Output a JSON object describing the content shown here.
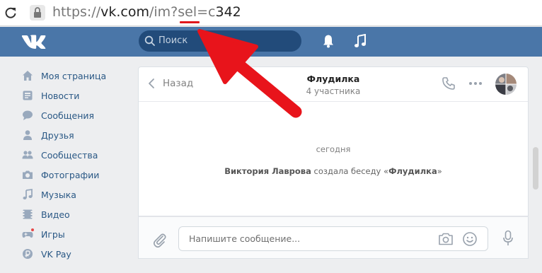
{
  "browser": {
    "url_proto": "https://",
    "url_host": "vk.com",
    "url_path": "/im?sel=c",
    "url_highlight": "342"
  },
  "header": {
    "search_placeholder": "Поиск",
    "brand_color": "#4a76a8"
  },
  "sidebar": {
    "items": [
      {
        "label": "Моя страница",
        "icon": "home-icon"
      },
      {
        "label": "Новости",
        "icon": "news-icon"
      },
      {
        "label": "Сообщения",
        "icon": "messages-icon"
      },
      {
        "label": "Друзья",
        "icon": "friend-icon"
      },
      {
        "label": "Сообщества",
        "icon": "communities-icon"
      },
      {
        "label": "Фотографии",
        "icon": "camera-icon"
      },
      {
        "label": "Музыка",
        "icon": "music-icon"
      },
      {
        "label": "Видео",
        "icon": "video-icon"
      },
      {
        "label": "Игры",
        "icon": "gamepad-icon"
      },
      {
        "label": "VK Pay",
        "icon": "vkpay-icon"
      }
    ]
  },
  "chat": {
    "back_label": "Назад",
    "title": "Флудилка",
    "subtitle": "4 участника",
    "date_divider": "сегодня",
    "event_author": "Виктория Лаврова",
    "event_text": " создала беседу «",
    "event_chat": "Флудилка",
    "event_end": "»"
  },
  "composer": {
    "placeholder": "Напишите сообщение..."
  },
  "annotation": {
    "arrow_color": "#e0161b"
  }
}
